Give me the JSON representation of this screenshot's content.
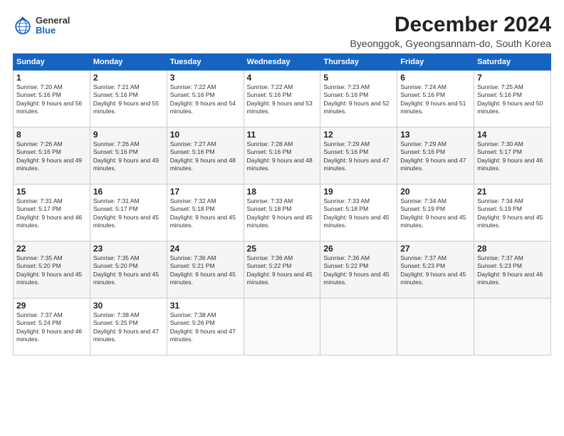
{
  "logo": {
    "general": "General",
    "blue": "Blue"
  },
  "title": "December 2024",
  "subtitle": "Byeonggok, Gyeongsannam-do, South Korea",
  "days_of_week": [
    "Sunday",
    "Monday",
    "Tuesday",
    "Wednesday",
    "Thursday",
    "Friday",
    "Saturday"
  ],
  "weeks": [
    [
      {
        "day": "1",
        "sunrise": "7:20 AM",
        "sunset": "5:16 PM",
        "daylight": "9 hours and 56 minutes."
      },
      {
        "day": "2",
        "sunrise": "7:21 AM",
        "sunset": "5:16 PM",
        "daylight": "9 hours and 55 minutes."
      },
      {
        "day": "3",
        "sunrise": "7:22 AM",
        "sunset": "5:16 PM",
        "daylight": "9 hours and 54 minutes."
      },
      {
        "day": "4",
        "sunrise": "7:22 AM",
        "sunset": "5:16 PM",
        "daylight": "9 hours and 53 minutes."
      },
      {
        "day": "5",
        "sunrise": "7:23 AM",
        "sunset": "5:16 PM",
        "daylight": "9 hours and 52 minutes."
      },
      {
        "day": "6",
        "sunrise": "7:24 AM",
        "sunset": "5:16 PM",
        "daylight": "9 hours and 51 minutes."
      },
      {
        "day": "7",
        "sunrise": "7:25 AM",
        "sunset": "5:16 PM",
        "daylight": "9 hours and 50 minutes."
      }
    ],
    [
      {
        "day": "8",
        "sunrise": "7:26 AM",
        "sunset": "5:16 PM",
        "daylight": "9 hours and 49 minutes."
      },
      {
        "day": "9",
        "sunrise": "7:26 AM",
        "sunset": "5:16 PM",
        "daylight": "9 hours and 49 minutes."
      },
      {
        "day": "10",
        "sunrise": "7:27 AM",
        "sunset": "5:16 PM",
        "daylight": "9 hours and 48 minutes."
      },
      {
        "day": "11",
        "sunrise": "7:28 AM",
        "sunset": "5:16 PM",
        "daylight": "9 hours and 48 minutes."
      },
      {
        "day": "12",
        "sunrise": "7:29 AM",
        "sunset": "5:16 PM",
        "daylight": "9 hours and 47 minutes."
      },
      {
        "day": "13",
        "sunrise": "7:29 AM",
        "sunset": "5:16 PM",
        "daylight": "9 hours and 47 minutes."
      },
      {
        "day": "14",
        "sunrise": "7:30 AM",
        "sunset": "5:17 PM",
        "daylight": "9 hours and 46 minutes."
      }
    ],
    [
      {
        "day": "15",
        "sunrise": "7:31 AM",
        "sunset": "5:17 PM",
        "daylight": "9 hours and 46 minutes."
      },
      {
        "day": "16",
        "sunrise": "7:31 AM",
        "sunset": "5:17 PM",
        "daylight": "9 hours and 45 minutes."
      },
      {
        "day": "17",
        "sunrise": "7:32 AM",
        "sunset": "5:18 PM",
        "daylight": "9 hours and 45 minutes."
      },
      {
        "day": "18",
        "sunrise": "7:33 AM",
        "sunset": "5:18 PM",
        "daylight": "9 hours and 45 minutes."
      },
      {
        "day": "19",
        "sunrise": "7:33 AM",
        "sunset": "5:18 PM",
        "daylight": "9 hours and 45 minutes."
      },
      {
        "day": "20",
        "sunrise": "7:34 AM",
        "sunset": "5:19 PM",
        "daylight": "9 hours and 45 minutes."
      },
      {
        "day": "21",
        "sunrise": "7:34 AM",
        "sunset": "5:19 PM",
        "daylight": "9 hours and 45 minutes."
      }
    ],
    [
      {
        "day": "22",
        "sunrise": "7:35 AM",
        "sunset": "5:20 PM",
        "daylight": "9 hours and 45 minutes."
      },
      {
        "day": "23",
        "sunrise": "7:35 AM",
        "sunset": "5:20 PM",
        "daylight": "9 hours and 45 minutes."
      },
      {
        "day": "24",
        "sunrise": "7:36 AM",
        "sunset": "5:21 PM",
        "daylight": "9 hours and 45 minutes."
      },
      {
        "day": "25",
        "sunrise": "7:36 AM",
        "sunset": "5:22 PM",
        "daylight": "9 hours and 45 minutes."
      },
      {
        "day": "26",
        "sunrise": "7:36 AM",
        "sunset": "5:22 PM",
        "daylight": "9 hours and 45 minutes."
      },
      {
        "day": "27",
        "sunrise": "7:37 AM",
        "sunset": "5:23 PM",
        "daylight": "9 hours and 45 minutes."
      },
      {
        "day": "28",
        "sunrise": "7:37 AM",
        "sunset": "5:23 PM",
        "daylight": "9 hours and 46 minutes."
      }
    ],
    [
      {
        "day": "29",
        "sunrise": "7:37 AM",
        "sunset": "5:24 PM",
        "daylight": "9 hours and 46 minutes."
      },
      {
        "day": "30",
        "sunrise": "7:38 AM",
        "sunset": "5:25 PM",
        "daylight": "9 hours and 47 minutes."
      },
      {
        "day": "31",
        "sunrise": "7:38 AM",
        "sunset": "5:26 PM",
        "daylight": "9 hours and 47 minutes."
      },
      null,
      null,
      null,
      null
    ]
  ],
  "labels": {
    "sunrise": "Sunrise:",
    "sunset": "Sunset:",
    "daylight": "Daylight:"
  }
}
